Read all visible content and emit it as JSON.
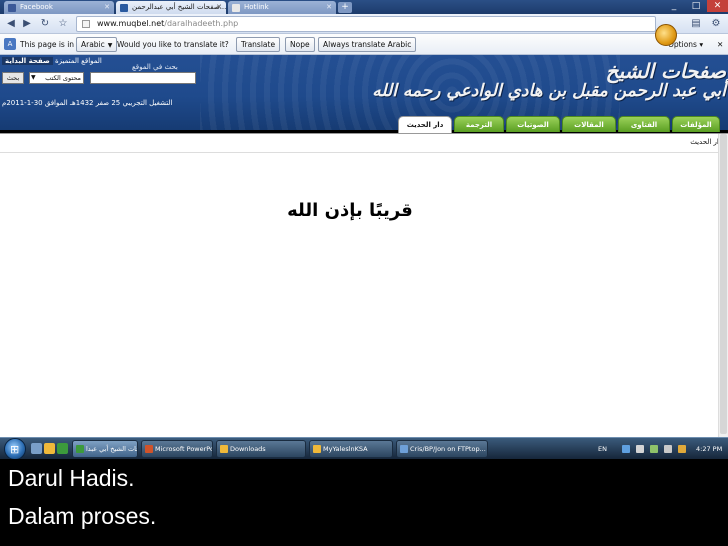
{
  "browser": {
    "tabs": [
      {
        "label": "Facebook",
        "active": false
      },
      {
        "label": "صفحات الشيخ أبي عبدالرحمن...",
        "active": true
      },
      {
        "label": "Hotlink",
        "active": false
      }
    ],
    "window_controls": [
      "_",
      "□",
      "✕"
    ],
    "address": {
      "host": "www.muqbel.net",
      "path": "/daralhadeeth.php"
    }
  },
  "translate_bar": {
    "prefix": "This page is in",
    "language": "Arabic",
    "question": "Would you like to translate it?",
    "translate_label": "Translate",
    "nope_label": "Nope",
    "always_label": "Always translate Arabic",
    "options_label": "Options ▾",
    "close_label": "✕"
  },
  "site": {
    "top_links": {
      "highlight": "صفحة البداية",
      "link": "المواقع المتميزة"
    },
    "search_label": "بحث في الموقع",
    "search_button": "بحث",
    "search_scope": "محتوى الكتب",
    "tagline": "التشغيل التجريبي 25 صفر 1432هـ الموافق 30-1-2011م",
    "logo_line1": "صفحات الشيخ",
    "logo_line2": "أبي عبد الرحمن مقبل بن هادي الوادعي رحمه الله",
    "nav": [
      {
        "label": "المؤلفات",
        "active": false
      },
      {
        "label": "الفتاوى",
        "active": false
      },
      {
        "label": "المقالات",
        "active": false
      },
      {
        "label": "الصوتيات",
        "active": false
      },
      {
        "label": "الترجمة",
        "active": false
      },
      {
        "label": "دار الحديث",
        "active": true
      }
    ],
    "breadcrumb": "دار الحديث",
    "main_message": "قريبًا بإذن الله"
  },
  "taskbar": {
    "tasks": [
      "صفحات الشيخ أبي عبدا...",
      "Microsoft PowerPoi...",
      "Downloads",
      "MyYaleslnKSA",
      "Cris/BP/Jon on FTPtop..."
    ],
    "language": "EN",
    "time": "4:27 PM"
  },
  "captions": [
    "Darul Hadis.",
    "Dalam proses."
  ]
}
